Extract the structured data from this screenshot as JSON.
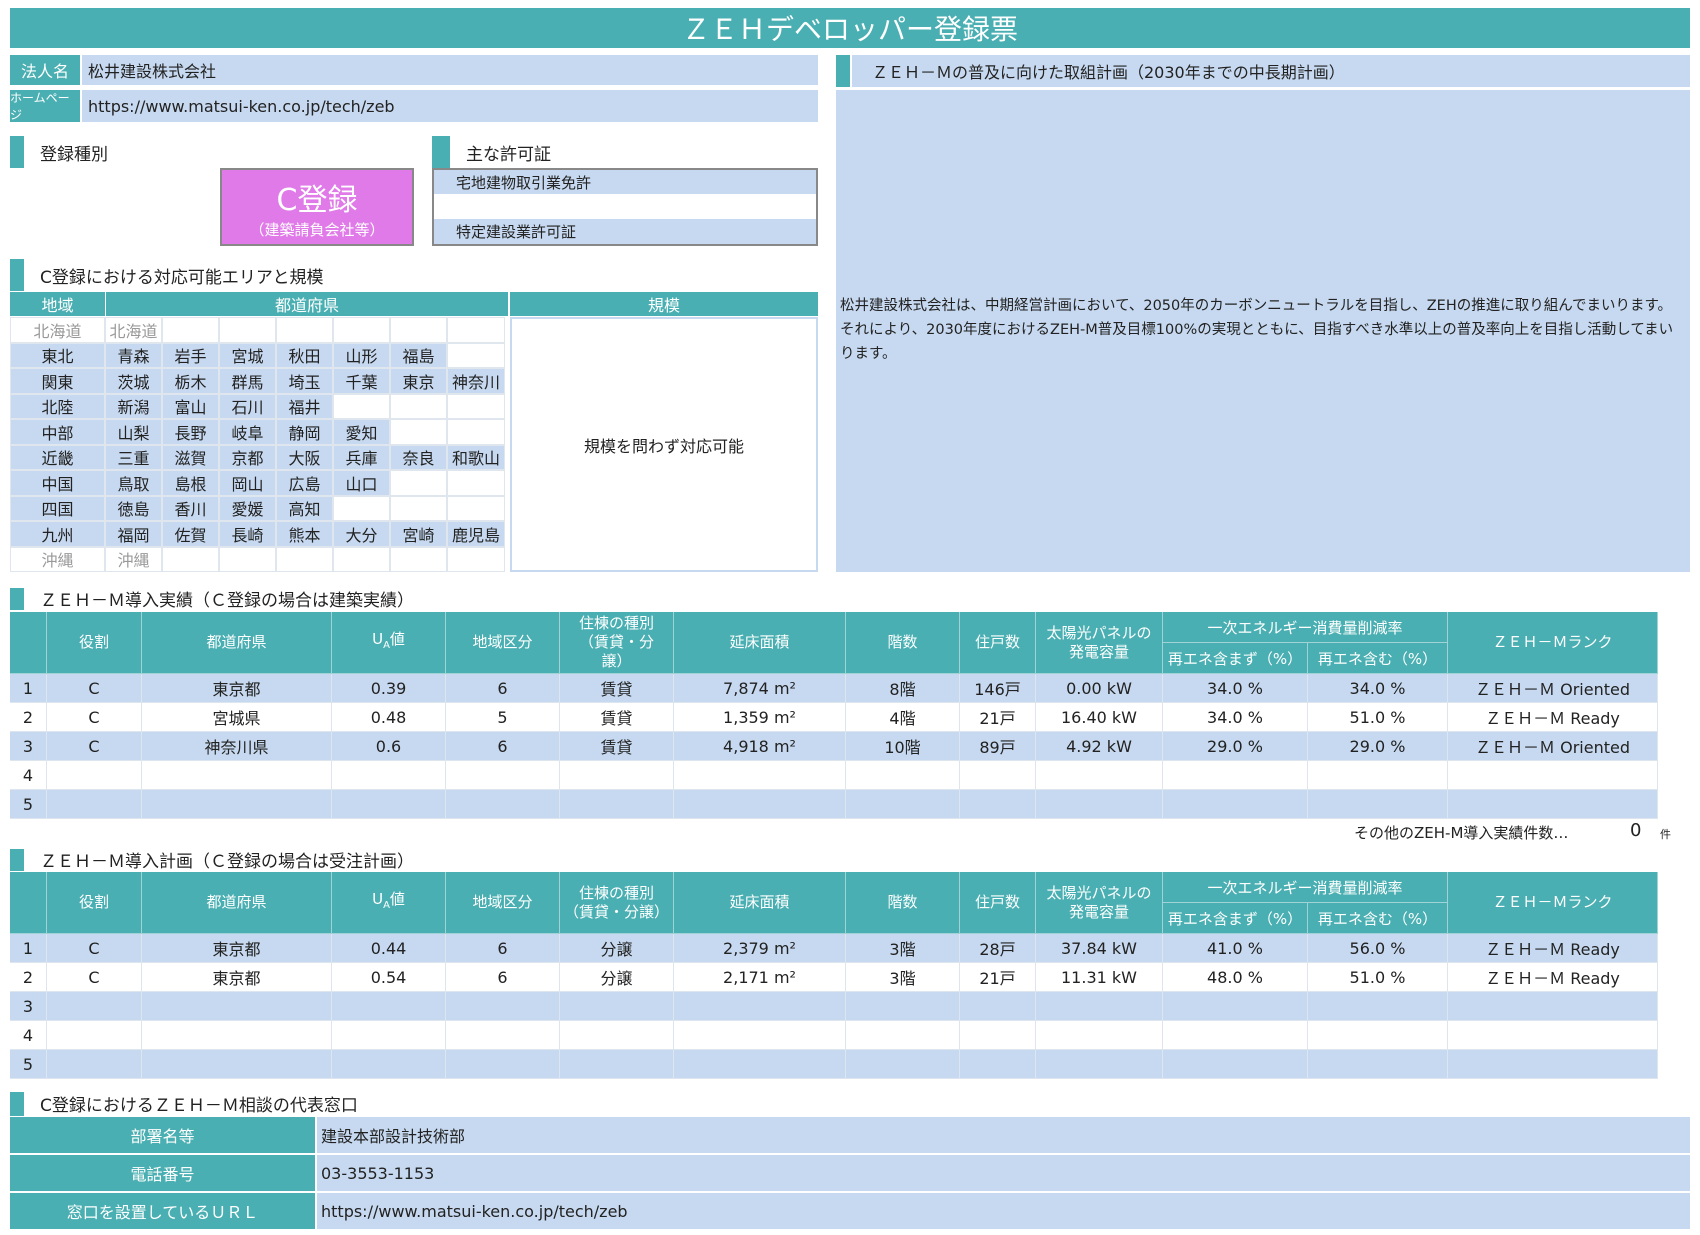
{
  "title": "ＺＥＨデベロッパー登録票",
  "company": {
    "name_label": "法人名",
    "name": "松井建設株式会社",
    "hp_label": "ホームページ",
    "hp": "https://www.matsui-ken.co.jp/tech/zeb"
  },
  "reg": {
    "label": "登録種別",
    "type": "C登録",
    "sub": "（建築請負会社等）"
  },
  "license": {
    "label": "主な許可証",
    "items": [
      "宅地建物取引業免許",
      "",
      "特定建設業許可証"
    ]
  },
  "area": {
    "label": "C登録における対応可能エリアと規模",
    "h_region": "地域",
    "h_pref": "都道府県",
    "h_scale": "規模",
    "scale_text": "規模を問わず対応可能",
    "rows": [
      {
        "r": "北海道",
        "p": [
          "北海道",
          "",
          "",
          "",
          "",
          "",
          ""
        ],
        "dim": true
      },
      {
        "r": "東北",
        "p": [
          "青森",
          "岩手",
          "宮城",
          "秋田",
          "山形",
          "福島",
          ""
        ]
      },
      {
        "r": "関東",
        "p": [
          "茨城",
          "栃木",
          "群馬",
          "埼玉",
          "千葉",
          "東京",
          "神奈川"
        ]
      },
      {
        "r": "北陸",
        "p": [
          "新潟",
          "富山",
          "石川",
          "福井",
          "",
          "",
          ""
        ]
      },
      {
        "r": "中部",
        "p": [
          "山梨",
          "長野",
          "岐阜",
          "静岡",
          "愛知",
          "",
          ""
        ]
      },
      {
        "r": "近畿",
        "p": [
          "三重",
          "滋賀",
          "京都",
          "大阪",
          "兵庫",
          "奈良",
          "和歌山"
        ]
      },
      {
        "r": "中国",
        "p": [
          "鳥取",
          "島根",
          "岡山",
          "広島",
          "山口",
          "",
          ""
        ]
      },
      {
        "r": "四国",
        "p": [
          "徳島",
          "香川",
          "愛媛",
          "高知",
          "",
          "",
          ""
        ]
      },
      {
        "r": "九州",
        "p": [
          "福岡",
          "佐賀",
          "長崎",
          "熊本",
          "大分",
          "宮崎",
          "鹿児島"
        ]
      },
      {
        "r": "沖縄",
        "p": [
          "沖縄",
          "",
          "",
          "",
          "",
          "",
          ""
        ],
        "dim": true
      }
    ]
  },
  "plan": {
    "label": "ＺＥＨ－Ｍの普及に向けた取組計画（2030年までの中長期計画）",
    "text": "松井建設株式会社は、中期経営計画において、2050年のカーボンニュートラルを目指し、ZEHの推進に取り組んでまいります。それにより、2030年度におけるZEH-M普及目標100%の実現とともに、目指すべき水準以上の普及率向上を目指し活動してまいります。"
  },
  "headers": {
    "role": "役割",
    "pref": "都道府県",
    "ua": "U",
    "ua_sub": "A",
    "ua_suf": "値",
    "zone": "地域区分",
    "kind1": "住棟の種別",
    "kind2": "（賃貸・分譲）",
    "kind2a": "（賃貸・分",
    "kind2b": "譲）",
    "area": "延床面積",
    "floors": "階数",
    "units": "住戸数",
    "solar1": "太陽光パネルの",
    "solar2": "発電容量",
    "energy": "一次エネルギー消費量削減率",
    "ex": "再エネ含まず（%）",
    "in": "再エネ含む（%）",
    "rank": "ＺＥＨ－Ｍランク"
  },
  "results": {
    "label": "ＺＥＨ－Ｍ導入実績（Ｃ登録の場合は建築実績）",
    "rows": [
      [
        "1",
        "C",
        "東京都",
        "0.39",
        "6",
        "賃貸",
        "7,874 m²",
        "8階",
        "146戸",
        "0.00 kW",
        "34.0 %",
        "34.0 %",
        "ＺＥＨ－Ｍ Oriented"
      ],
      [
        "2",
        "C",
        "宮城県",
        "0.48",
        "5",
        "賃貸",
        "1,359 m²",
        "4階",
        "21戸",
        "16.40 kW",
        "34.0 %",
        "51.0 %",
        "ＺＥＨ－Ｍ Ready"
      ],
      [
        "3",
        "C",
        "神奈川県",
        "0.6",
        "6",
        "賃貸",
        "4,918 m²",
        "10階",
        "89戸",
        "4.92 kW",
        "29.0 %",
        "29.0 %",
        "ＺＥＨ－Ｍ Oriented"
      ],
      [
        "4",
        "",
        "",
        "",
        "",
        "",
        "",
        "",
        "",
        "",
        "",
        "",
        ""
      ],
      [
        "5",
        "",
        "",
        "",
        "",
        "",
        "",
        "",
        "",
        "",
        "",
        "",
        ""
      ]
    ],
    "other_label": "その他のZEH-M導入実績件数…",
    "other_count": "0",
    "other_unit": "件"
  },
  "plans": {
    "label": "ＺＥＨ－Ｍ導入計画（Ｃ登録の場合は受注計画）",
    "rows": [
      [
        "1",
        "C",
        "東京都",
        "0.44",
        "6",
        "分譲",
        "2,379 m²",
        "3階",
        "28戸",
        "37.84 kW",
        "41.0 %",
        "56.0 %",
        "ＺＥＨ－Ｍ Ready"
      ],
      [
        "2",
        "C",
        "東京都",
        "0.54",
        "6",
        "分譲",
        "2,171 m²",
        "3階",
        "21戸",
        "11.31 kW",
        "48.0 %",
        "51.0 %",
        "ＺＥＨ－Ｍ Ready"
      ],
      [
        "3",
        "",
        "",
        "",
        "",
        "",
        "",
        "",
        "",
        "",
        "",
        "",
        ""
      ],
      [
        "4",
        "",
        "",
        "",
        "",
        "",
        "",
        "",
        "",
        "",
        "",
        "",
        ""
      ],
      [
        "5",
        "",
        "",
        "",
        "",
        "",
        "",
        "",
        "",
        "",
        "",
        "",
        ""
      ]
    ]
  },
  "contact": {
    "label": "C登録におけるＺＥＨ－Ｍ相談の代表窓口",
    "dept_label": "部署名等",
    "dept": "建設本部設計技術部",
    "tel_label": "電話番号",
    "tel": "03-3553-1153",
    "url_label": "窓口を設置しているＵＲＬ",
    "url": "https://www.matsui-ken.co.jp/tech/zeb"
  }
}
